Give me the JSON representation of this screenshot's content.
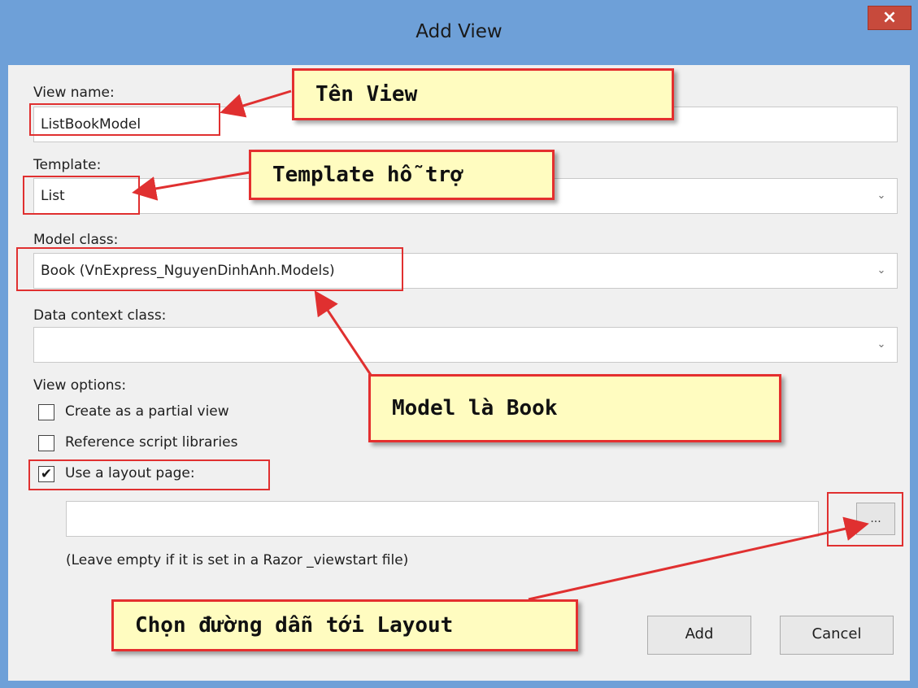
{
  "window": {
    "title": "Add View",
    "close_symbol": "×"
  },
  "form": {
    "view_name_label": "View name:",
    "view_name_value": "ListBookModel",
    "template_label": "Template:",
    "template_value": "List",
    "model_class_label": "Model class:",
    "model_class_value": "Book (VnExpress_NguyenDinhAnh.Models)",
    "data_context_label": "Data context class:",
    "data_context_value": "",
    "dropdown_arrow": "⌄",
    "view_options_label": "View options:",
    "options": [
      {
        "label": "Create as a partial view",
        "checked": false
      },
      {
        "label": "Reference script libraries",
        "checked": false
      },
      {
        "label": "Use a layout page:",
        "checked": true
      }
    ],
    "check_mark": "✔",
    "layout_path_value": "",
    "browse_label": "...",
    "hint": "(Leave empty if it is set in a Razor _viewstart file)"
  },
  "buttons": {
    "add": "Add",
    "cancel": "Cancel"
  },
  "annotations": {
    "view_name": "Tên View",
    "template": "Template hỗ trợ",
    "model": "Model là Book",
    "layout": "Chọn đường dẫn tới Layout"
  },
  "colors": {
    "titlebar": "#6ea0d8",
    "annotation_border": "#e03030",
    "annotation_fill": "#fffcc0",
    "close": "#c74a3c"
  }
}
